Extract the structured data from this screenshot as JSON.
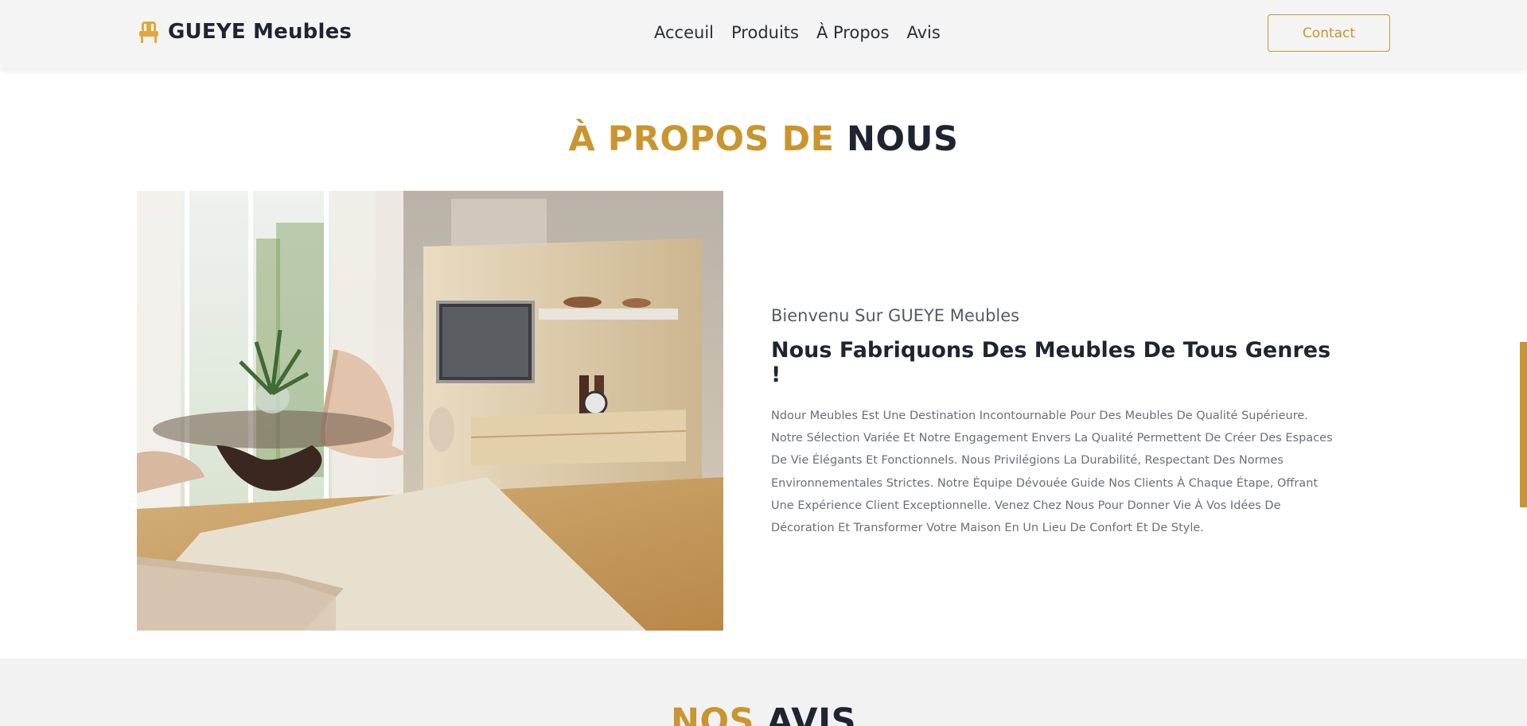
{
  "header": {
    "brand": "GUEYE Meubles",
    "brand_icon": "chair-icon",
    "nav": [
      "Acceuil",
      "Produits",
      "À Propos",
      "Avis"
    ],
    "contact_label": "Contact"
  },
  "about": {
    "title_accent": "À PROPOS DE ",
    "title_dark": "NOUS",
    "subtitle": "Bienvenu Sur GUEYE Meubles",
    "heading": "Nous Fabriquons Des Meubles De Tous Genres !",
    "paragraph": "Ndour Meubles Est Une Destination Incontournable Pour Des Meubles De Qualité Supérieure. Notre Sélection Variée Et Notre Engagement Envers La Qualité Permettent De Créer Des Espaces De Vie Élégants Et Fonctionnels. Nous Privilégions La Durabilité, Respectant Des Normes Environnementales Strictes. Notre Équipe Dévouée Guide Nos Clients À Chaque Étape, Offrant Une Expérience Client Exceptionnelle. Venez Chez Nous Pour Donner Vie À Vos Idées De Décoration Et Transformer Votre Maison En Un Lieu De Confort Et De Style."
  },
  "avis": {
    "title_accent": "NOS ",
    "title_dark": "AVIS"
  },
  "colors": {
    "accent": "#c9952e",
    "dark": "#1f2430",
    "header_bg": "#f4f4f4",
    "section_alt_bg": "#f2f2f2"
  }
}
